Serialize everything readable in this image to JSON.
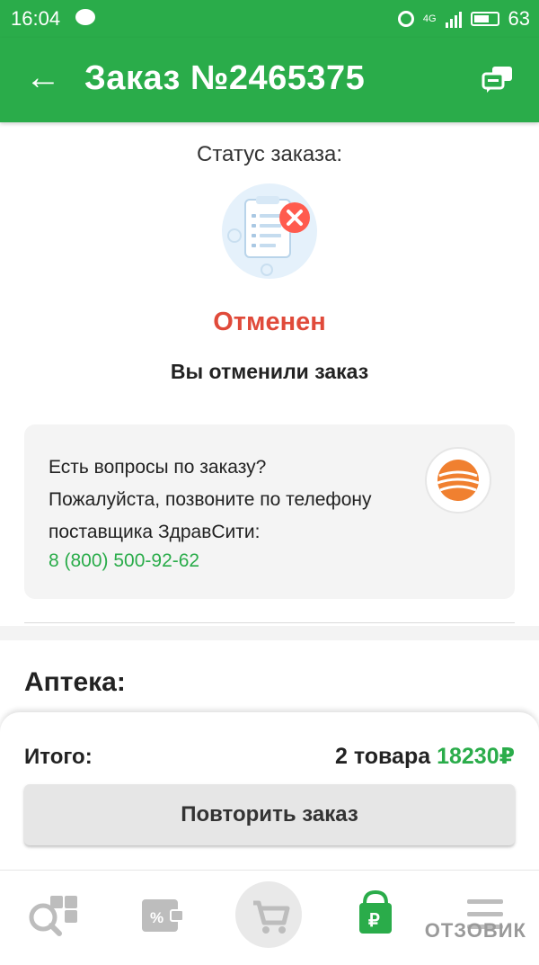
{
  "status_bar": {
    "time": "16:04",
    "network": "4G",
    "battery": "63"
  },
  "header": {
    "title": "Заказ №2465375"
  },
  "status": {
    "label": "Статус заказа:",
    "value": "Отменен",
    "message": "Вы отменили заказ"
  },
  "help": {
    "line1": "Есть вопросы по заказу?",
    "line2": "Пожалуйста, позвоните по телефону",
    "line3": "поставщика ЗдравСити:",
    "phone": "8 (800) 500-92-62"
  },
  "pharmacy": {
    "heading": "Аптека:"
  },
  "summary": {
    "total_label": "Итого:",
    "items_count": "2 товара",
    "total_price": "18230₽",
    "repeat_button": "Повторить заказ"
  },
  "nav": {
    "items": [
      "search-catalog-icon",
      "discounts-icon",
      "cart-icon",
      "orders-icon",
      "menu-icon"
    ]
  },
  "watermark": "ОТЗОВИК",
  "colors": {
    "brand_green": "#2aac4a",
    "cancel_red": "#e04a3a"
  }
}
